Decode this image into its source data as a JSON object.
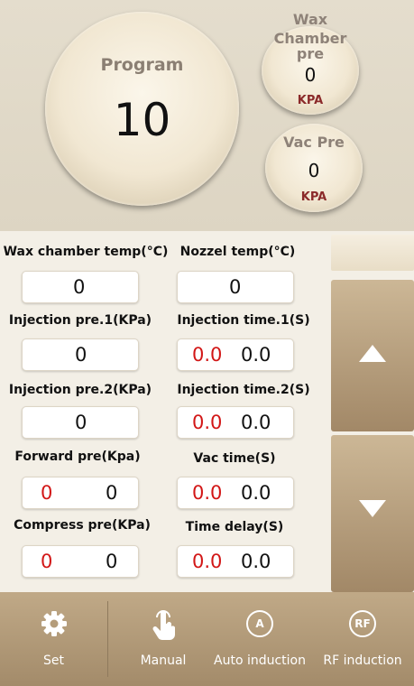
{
  "header": {
    "program": {
      "label": "Program",
      "value": "10"
    },
    "wax_chamber_pre": {
      "label_line1": "Wax",
      "label_line2": "Chamber pre",
      "value": "0",
      "unit": "KPA"
    },
    "vac_pre": {
      "label": "Vac Pre",
      "value": "0",
      "unit": "KPA"
    }
  },
  "params": {
    "wax_chamber_temp": {
      "label": "Wax chamber temp(°C)",
      "value": "0"
    },
    "nozzel_temp": {
      "label": "Nozzel temp(°C)",
      "value": "0"
    },
    "injection_pre1": {
      "label": "Injection pre.1(KPa)",
      "value": "0"
    },
    "injection_time1": {
      "label": "Injection time.1(S)",
      "current": "0.0",
      "set": "0.0"
    },
    "injection_pre2": {
      "label": "Injection pre.2(KPa)",
      "value": "0"
    },
    "injection_time2": {
      "label": "Injection time.2(S)",
      "current": "0.0",
      "set": "0.0"
    },
    "forward_pre": {
      "label": "Forward pre(Kpa)",
      "current": "0",
      "set": "0"
    },
    "vac_time": {
      "label": "Vac time(S)",
      "current": "0.0",
      "set": "0.0"
    },
    "compress_pre": {
      "label": "Compress pre(KPa)",
      "current": "0",
      "set": "0"
    },
    "time_delay": {
      "label": "Time delay(S)",
      "current": "0.0",
      "set": "0.0"
    }
  },
  "nav": {
    "set": "Set",
    "manual": "Manual",
    "auto_induction": "Auto induction",
    "auto_icon": "A",
    "rf_induction": "RF induction",
    "rf_icon": "RF"
  },
  "colors": {
    "accent": "#a89070",
    "current_value": "#d21616"
  }
}
